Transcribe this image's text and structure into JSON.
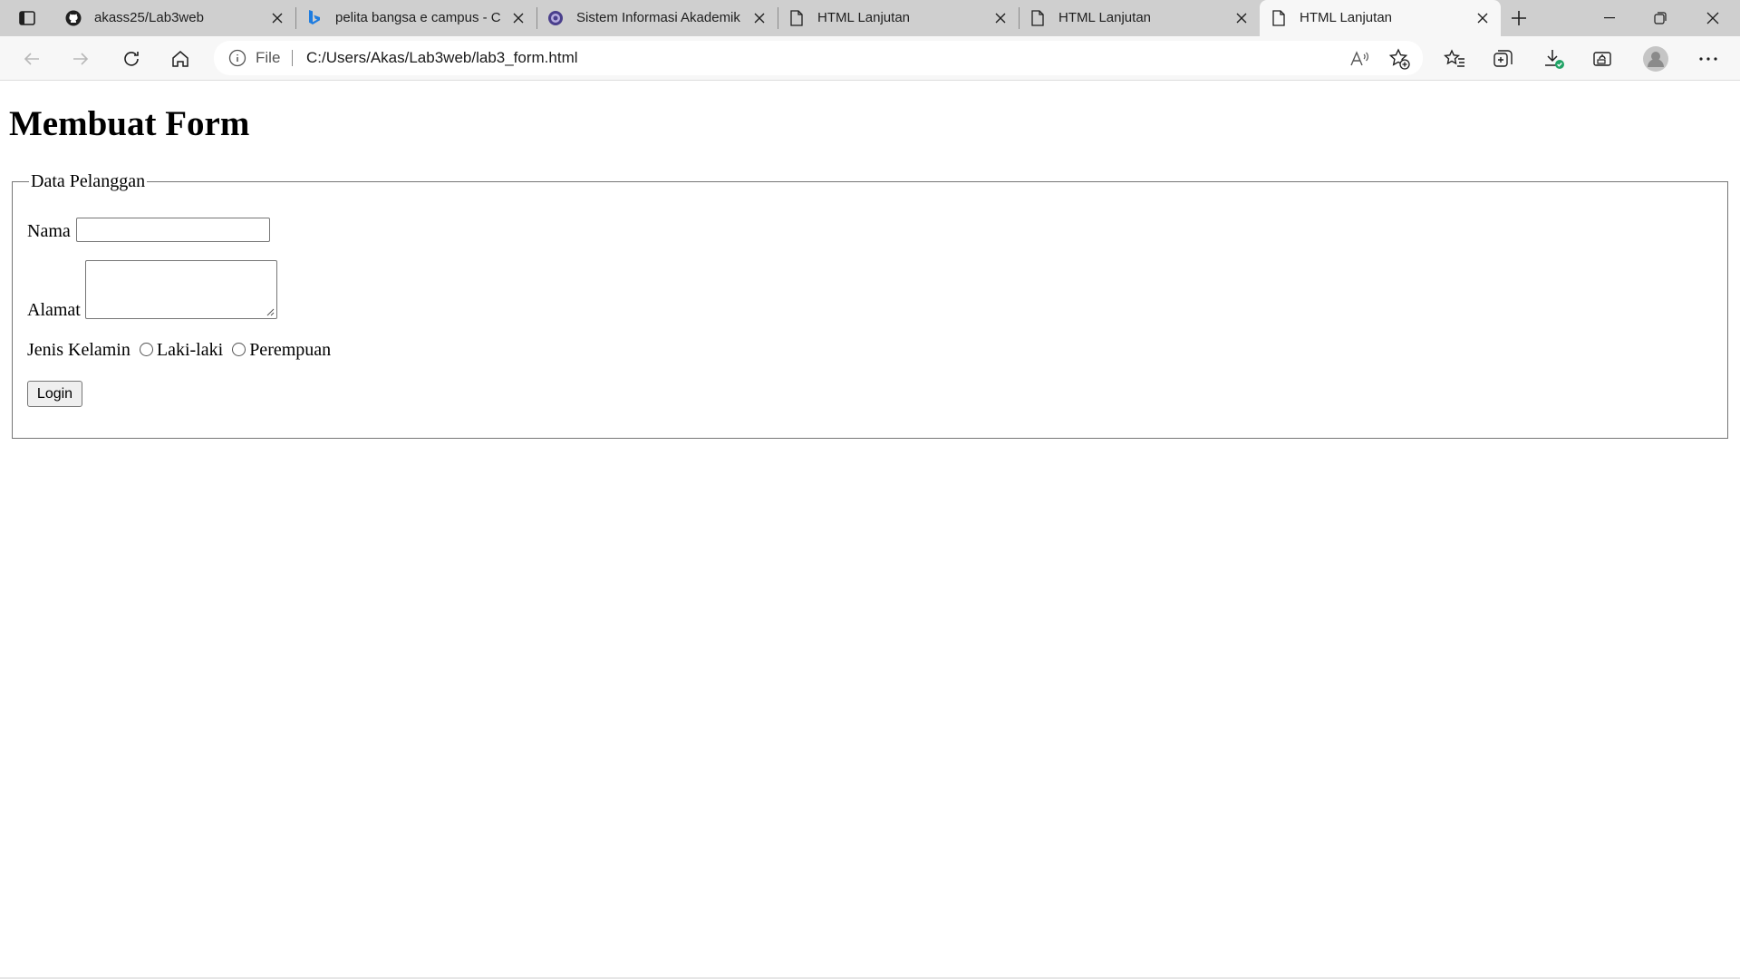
{
  "tabs": [
    {
      "title": "akass25/Lab3web",
      "icon": "github-icon",
      "active": false
    },
    {
      "title": "pelita bangsa e campus - C",
      "icon": "bing-icon",
      "active": false
    },
    {
      "title": "Sistem Informasi Akademik",
      "icon": "university-logo-icon",
      "active": false
    },
    {
      "title": "HTML Lanjutan",
      "icon": "document-icon",
      "active": false
    },
    {
      "title": "HTML Lanjutan",
      "icon": "document-icon",
      "active": false
    },
    {
      "title": "HTML Lanjutan",
      "icon": "document-icon",
      "active": true
    }
  ],
  "address": {
    "scheme": "File",
    "url": "C:/Users/Akas/Lab3web/lab3_form.html"
  },
  "page": {
    "heading": "Membuat Form",
    "legend": "Data Pelanggan",
    "nama_label": "Nama",
    "nama_value": "",
    "alamat_label": "Alamat",
    "alamat_value": "",
    "gender_label": "Jenis Kelamin",
    "gender_options": [
      "Laki-laki",
      "Perempuan"
    ],
    "submit_label": "Login"
  }
}
